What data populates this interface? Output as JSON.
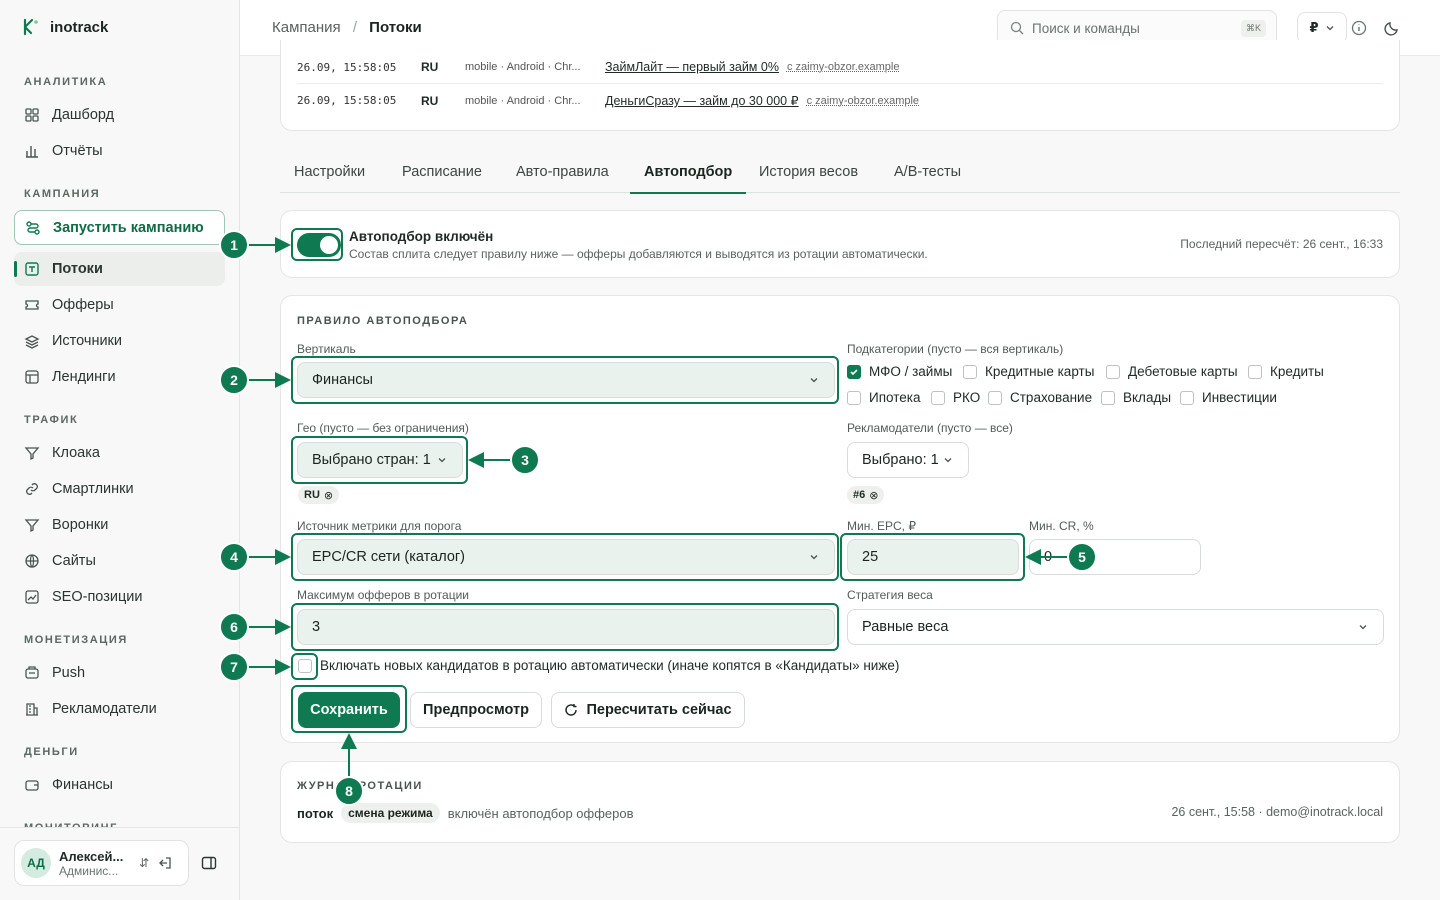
{
  "brand": {
    "name": "inotrack"
  },
  "sidebar": {
    "sections": [
      {
        "title": "АНАЛИТИКА"
      },
      {
        "title": "КАМПАНИЯ"
      },
      {
        "title": "ТРАФИК"
      },
      {
        "title": "МОНЕТИЗАЦИЯ"
      },
      {
        "title": "ДЕНЬГИ"
      },
      {
        "title": "МОНИТОРИНГ"
      }
    ],
    "items": [
      {
        "label": "Дашборд",
        "icon": "grid-icon"
      },
      {
        "label": "Отчёты",
        "icon": "bar-chart-icon"
      },
      {
        "label": "Запустить кампанию",
        "icon": "route-icon"
      },
      {
        "label": "Потоки",
        "icon": "flow-icon"
      },
      {
        "label": "Офферы",
        "icon": "ticket-icon"
      },
      {
        "label": "Источники",
        "icon": "stack-icon"
      },
      {
        "label": "Лендинги",
        "icon": "layout-icon"
      },
      {
        "label": "Клоака",
        "icon": "filter-icon"
      },
      {
        "label": "Смартлинки",
        "icon": "link-icon"
      },
      {
        "label": "Воронки",
        "icon": "funnel-icon"
      },
      {
        "label": "Сайты",
        "icon": "globe-icon"
      },
      {
        "label": "SEO-позиции",
        "icon": "trend-icon"
      },
      {
        "label": "Push",
        "icon": "push-icon"
      },
      {
        "label": "Рекламодатели",
        "icon": "building-icon"
      },
      {
        "label": "Финансы",
        "icon": "wallet-icon"
      }
    ],
    "user": {
      "initials": "АД",
      "name": "Алексей...",
      "role": "Админис..."
    }
  },
  "topbar": {
    "breadcrumb_parent": "Кампания",
    "breadcrumb_sep": "/",
    "breadcrumb_current": "Потоки",
    "search_placeholder": "Поиск и команды",
    "search_kbd": "⌘K",
    "currency": "₽"
  },
  "log_rows": [
    {
      "time": "26.09, 15:58:05",
      "geo": "RU",
      "device": "mobile · Android · Chr...",
      "offer": "ЗаймЛайт — первый займ 0%",
      "source": "с zaimy-obzor.example"
    },
    {
      "time": "26.09, 15:58:05",
      "geo": "RU",
      "device": "mobile · Android · Chr...",
      "offer": "ДеньгиСразу — займ до 30 000 ₽",
      "source": "с zaimy-obzor.example"
    }
  ],
  "tabs": [
    "Настройки",
    "Расписание",
    "Авто-правила",
    "Автоподбор",
    "История весов",
    "A/B-тесты"
  ],
  "autopick": {
    "title": "Автоподбор включён",
    "description": "Состав сплита следует правилу ниже — офферы добавляются и выводятся из ротации автоматически.",
    "last_recalc": "Последний пересчёт: 26 сент., 16:33",
    "enabled": true
  },
  "rule": {
    "heading": "ПРАВИЛО АВТОПОДБОРА",
    "vertical_label": "Вертикаль",
    "vertical_value": "Финансы",
    "subcat_label": "Подкатегории (пусто — вся вертикаль)",
    "subcats": [
      {
        "label": "МФО / займы",
        "checked": true
      },
      {
        "label": "Кредитные карты",
        "checked": false
      },
      {
        "label": "Дебетовые карты",
        "checked": false
      },
      {
        "label": "Кредиты",
        "checked": false
      },
      {
        "label": "Ипотека",
        "checked": false
      },
      {
        "label": "РКО",
        "checked": false
      },
      {
        "label": "Страхование",
        "checked": false
      },
      {
        "label": "Вклады",
        "checked": false
      },
      {
        "label": "Инвестиции",
        "checked": false
      }
    ],
    "geo_label": "Гео (пусто — без ограничения)",
    "geo_value": "Выбрано стран: 1",
    "geo_chip": "RU",
    "adv_label": "Рекламодатели (пусто — все)",
    "adv_value": "Выбрано: 1",
    "adv_chip": "#6",
    "metric_label": "Источник метрики для порога",
    "metric_value": "EPC/CR сети (каталог)",
    "epc_label": "Мин. EPC, ₽",
    "epc_value": "25",
    "cr_label": "Мин. CR, %",
    "cr_value": "0",
    "max_label": "Максимум офферов в ротации",
    "max_value": "3",
    "strategy_label": "Стратегия веса",
    "strategy_value": "Равные веса",
    "auto_include_label": "Включать новых кандидатов в ротацию автоматически (иначе копятся в «Кандидаты» ниже)",
    "save": "Сохранить",
    "preview": "Предпросмотр",
    "recalc": "Пересчитать сейчас"
  },
  "journal": {
    "heading": "ЖУРНАЛ РОТАЦИИ",
    "entity": "поток",
    "tag": "смена режима",
    "text": "включён автоподбор офферов",
    "meta": "26 сент., 15:58 · demo@inotrack.local"
  },
  "callouts": [
    "1",
    "2",
    "3",
    "4",
    "5",
    "6",
    "7",
    "8"
  ]
}
